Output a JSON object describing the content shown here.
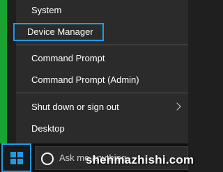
{
  "menu": {
    "items": [
      {
        "label": "System"
      },
      {
        "label": "Device Manager"
      },
      {
        "label": "Command Prompt"
      },
      {
        "label": "Command Prompt (Admin)"
      },
      {
        "label": "Shut down or sign out"
      },
      {
        "label": "Desktop"
      }
    ]
  },
  "taskbar": {
    "search_placeholder": "Ask me anything"
  },
  "watermark": "shenmazhishi.com",
  "colors": {
    "accent": "#1e9be8",
    "menu_bg": "#2b2b2b",
    "green_strip": "#1aa332"
  }
}
